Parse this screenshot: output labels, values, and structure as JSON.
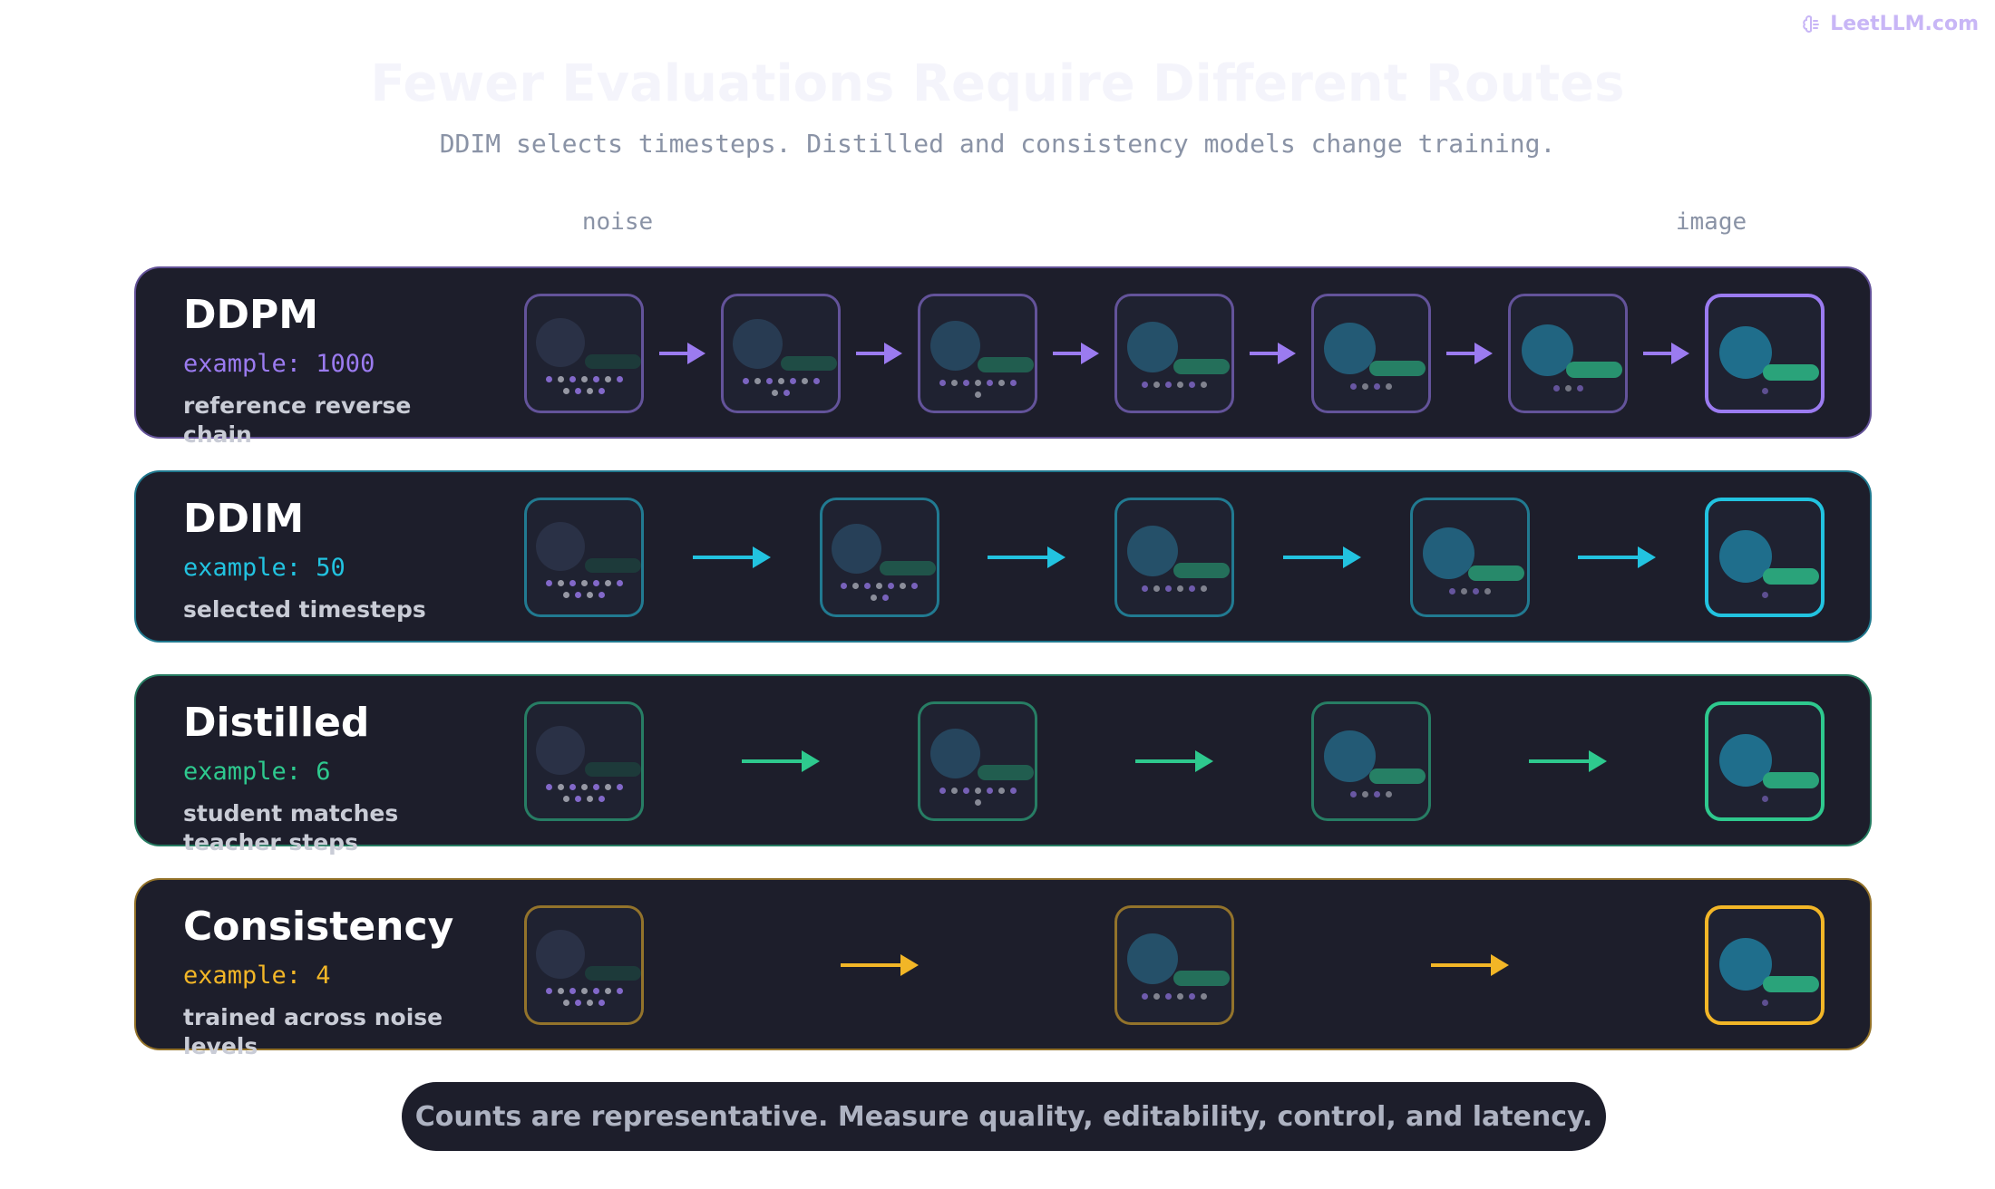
{
  "brand": {
    "label": "LeetLLM.com",
    "color": "#c8b6f6"
  },
  "title": "Fewer Evaluations Require Different Routes",
  "subtitle": "DDIM selects timesteps. Distilled and consistency models change training.",
  "axis": {
    "start_label": "noise",
    "end_label": "image"
  },
  "rows": [
    {
      "name": "DDPM",
      "example": "example: 1000",
      "description": "reference reverse chain",
      "color": "#9b7bf0",
      "steps": 7
    },
    {
      "name": "DDIM",
      "example": "example: 50",
      "description": "selected timesteps",
      "color": "#22c3e0",
      "steps": 5
    },
    {
      "name": "Distilled",
      "example": "example: 6",
      "description": "student matches teacher steps",
      "color": "#2ec98e",
      "steps": 4
    },
    {
      "name": "Consistency",
      "example": "example: 4",
      "description": "trained across noise levels",
      "color": "#f2b627",
      "steps": 3
    }
  ],
  "footer": "Counts are representative. Measure quality, editability, control, and latency."
}
